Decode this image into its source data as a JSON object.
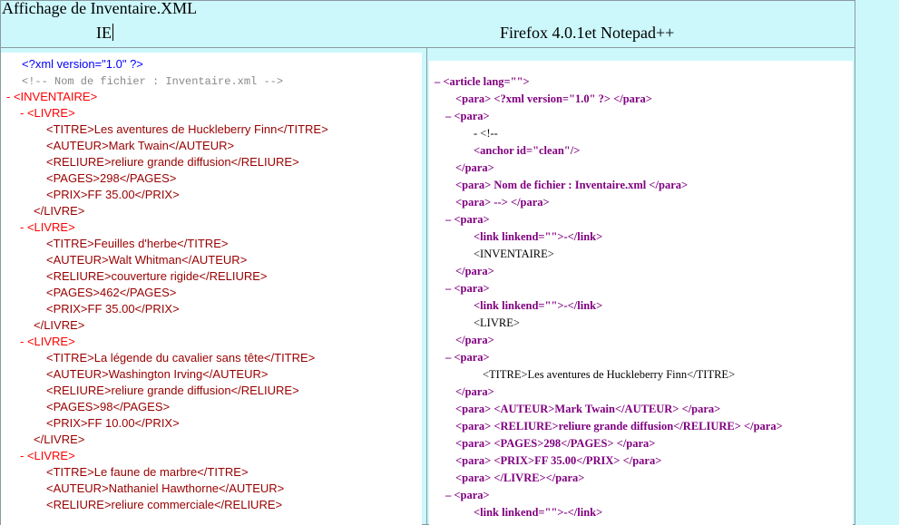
{
  "header": {
    "title": "Affichage de Inventaire.XML",
    "left_label": "IE",
    "right_label": "Firefox 4.0.1et Notepad++"
  },
  "ie_lines": [
    "<?xml version=\"1.0\" ?>",
    "<!--  Nom de fichier : Inventaire.xml   -->",
    "- <INVENTAIRE>",
    "- <LIVRE>",
    "<TITRE>Les aventures de Huckleberry Finn</TITRE>",
    "<AUTEUR>Mark Twain</AUTEUR>",
    "<RELIURE>reliure grande diffusion</RELIURE>",
    "<PAGES>298</PAGES>",
    "<PRIX>FF 35.00</PRIX>",
    "</LIVRE>",
    "- <LIVRE>",
    "<TITRE>Feuilles d'herbe</TITRE>",
    "<AUTEUR>Walt Whitman</AUTEUR>",
    "<RELIURE>couverture rigide</RELIURE>",
    "<PAGES>462</PAGES>",
    "<PRIX>FF 35.00</PRIX>",
    "</LIVRE>",
    "- <LIVRE>",
    "<TITRE>La légende du cavalier sans tête</TITRE>",
    "<AUTEUR>Washington Irving</AUTEUR>",
    "<RELIURE>reliure grande diffusion</RELIURE>",
    "<PAGES>98</PAGES>",
    "<PRIX>FF 10.00</PRIX>",
    "</LIVRE>",
    "- <LIVRE>",
    "<TITRE>Le faune de marbre</TITRE>",
    "<AUTEUR>Nathaniel Hawthorne</AUTEUR>",
    "<RELIURE>reliure commerciale</RELIURE>"
  ],
  "ff_lines": [
    "– <article lang=\"\">",
    "<para> <?xml version=\"1.0\" ?> </para>",
    "– <para>",
    "- <!--",
    "<anchor id=\"clean\"/>",
    "</para>",
    "<para> Nom de fichier : Inventaire.xml </para>",
    "<para> --> </para>",
    "– <para>",
    "<link linkend=\"\">-</link>",
    "<INVENTAIRE>",
    "</para>",
    "– <para>",
    "<link linkend=\"\">-</link>",
    "<LIVRE>",
    "</para>",
    "– <para>",
    "<TITRE>Les aventures de Huckleberry Finn</TITRE>",
    "</para>",
    "<para> <AUTEUR>Mark Twain</AUTEUR> </para>",
    "<para> <RELIURE>reliure grande diffusion</RELIURE> </para>",
    "<para> <PAGES>298</PAGES> </para>",
    "<para> <PRIX>FF 35.00</PRIX> </para>",
    "<para> </LIVRE></para>",
    "– <para>",
    "<link linkend=\"\">-</link>"
  ],
  "colors": {
    "background": "#ccf8fc",
    "ie_tag": "#990000",
    "ie_bracket": "#0000ee",
    "ie_minus": "#ff0000",
    "ff_tag": "#800080",
    "ff_attr_value": "#0000ff"
  }
}
